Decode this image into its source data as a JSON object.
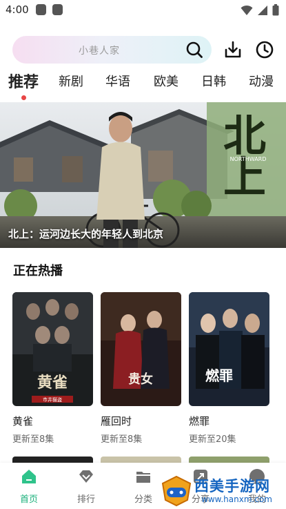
{
  "status_bar": {
    "time": "4:00"
  },
  "search": {
    "placeholder": "小巷人家"
  },
  "tabs": [
    {
      "label": "推荐",
      "active": true
    },
    {
      "label": "新剧"
    },
    {
      "label": "华语"
    },
    {
      "label": "欧美"
    },
    {
      "label": "日韩"
    },
    {
      "label": "动漫"
    }
  ],
  "banner": {
    "caption": "北上：运河边长大的年轻人到北京",
    "art_title": "北上",
    "art_subtitle": "NORTHWARD"
  },
  "section": {
    "title": "正在热播"
  },
  "cards": [
    {
      "title": "黄雀",
      "subtitle": "更新至8集",
      "poster_title": "黄雀",
      "poster_note": "市井猫盗"
    },
    {
      "title": "雁回时",
      "subtitle": "更新至8集",
      "poster_title": "贵女"
    },
    {
      "title": "燃罪",
      "subtitle": "更新至20集",
      "poster_title": "燃罪"
    }
  ],
  "bottom_nav": [
    {
      "label": "首页",
      "icon": "home-icon",
      "active": true
    },
    {
      "label": "排行",
      "icon": "rank-diamond-icon"
    },
    {
      "label": "分类",
      "icon": "folder-icon"
    },
    {
      "label": "分享",
      "icon": "share-icon"
    },
    {
      "label": "我的",
      "icon": "profile-icon"
    }
  ],
  "watermark": {
    "text": "西美手游网",
    "url": "www.hanxm.com"
  },
  "colors": {
    "accent": "#19b07a",
    "active_dot": "#e84545"
  }
}
